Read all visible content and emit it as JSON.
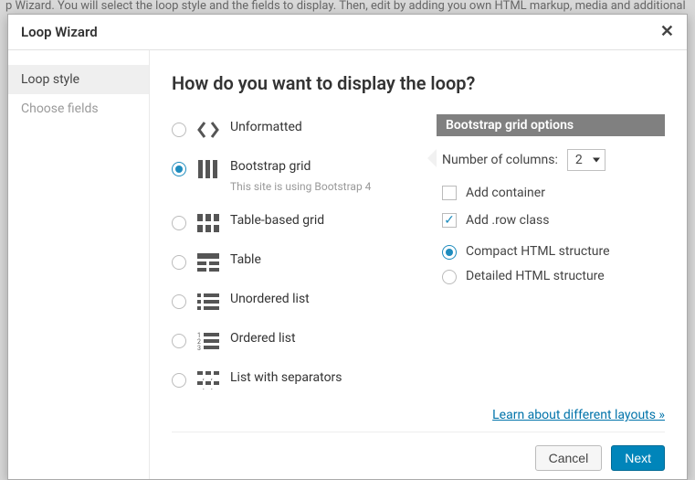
{
  "dialog": {
    "title": "Loop Wizard",
    "backdrop_text": "p Wizard. You will select the loop style and the fields to display. Then, edit by adding you own HTML markup, media and additional"
  },
  "sidebar": {
    "steps": [
      {
        "label": "Loop style",
        "active": true
      },
      {
        "label": "Choose fields",
        "active": false
      }
    ]
  },
  "main": {
    "heading": "How do you want to display the loop?",
    "options": [
      {
        "label": "Unformatted",
        "checked": false,
        "hint": ""
      },
      {
        "label": "Bootstrap grid",
        "checked": true,
        "hint": "This site is using Bootstrap 4"
      },
      {
        "label": "Table-based grid",
        "checked": false,
        "hint": ""
      },
      {
        "label": "Table",
        "checked": false,
        "hint": ""
      },
      {
        "label": "Unordered list",
        "checked": false,
        "hint": ""
      },
      {
        "label": "Ordered list",
        "checked": false,
        "hint": ""
      },
      {
        "label": "List with separators",
        "checked": false,
        "hint": ""
      }
    ]
  },
  "panel": {
    "title": "Bootstrap grid options",
    "cols_label": "Number of columns:",
    "cols_value": "2",
    "add_container_label": "Add container",
    "add_container_checked": false,
    "add_row_label": "Add .row class",
    "add_row_checked": true,
    "structure": {
      "compact": "Compact HTML structure",
      "detailed": "Detailed HTML structure",
      "selected": "compact"
    }
  },
  "footer": {
    "learn_link": "Learn about different layouts »",
    "cancel": "Cancel",
    "next": "Next"
  }
}
